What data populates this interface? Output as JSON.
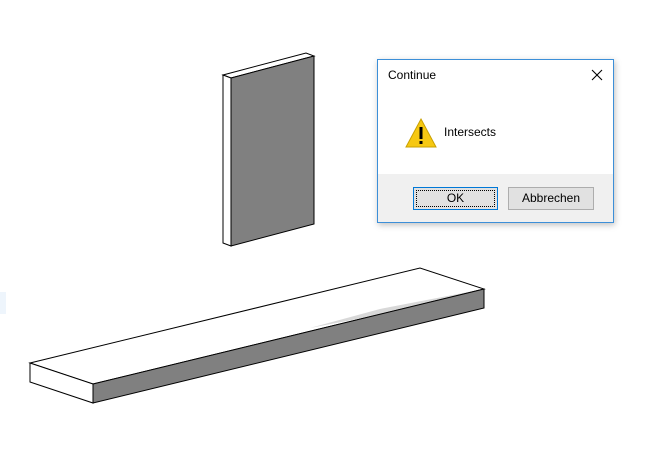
{
  "dialog": {
    "title": "Continue",
    "message": "Intersects",
    "ok_label": "OK",
    "cancel_label": "Abbrechen",
    "icon": "warning-icon",
    "close_icon": "close-icon"
  },
  "colors": {
    "dialog_border": "#3c8fd8",
    "footer_bg": "#f0f0f0",
    "button_bg": "#e1e1e1",
    "default_button_border": "#0078d7",
    "warning_fill": "#f6c812",
    "model_side_face": "#808080"
  }
}
